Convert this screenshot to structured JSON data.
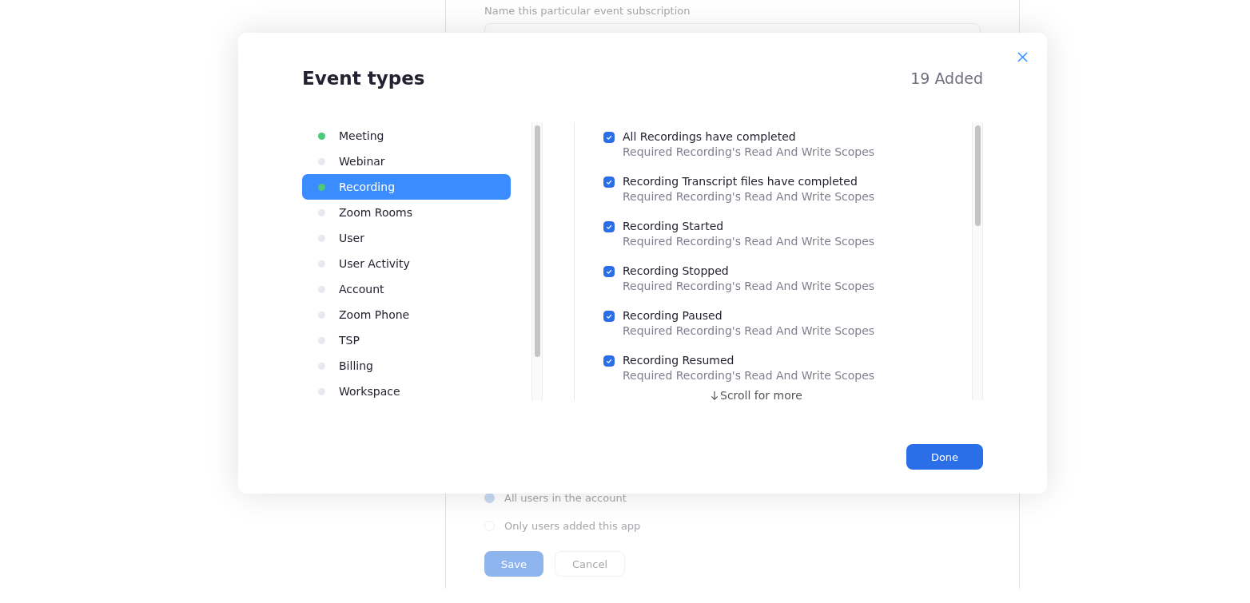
{
  "background_form": {
    "name_hint": "Name this particular event subscription",
    "user_options": [
      {
        "label": "All users in the account",
        "selected": true
      },
      {
        "label": "Only users added this app",
        "selected": false
      }
    ],
    "buttons": [
      {
        "kind": "primary",
        "label": "Save"
      },
      {
        "kind": "secondary",
        "label": "Cancel"
      }
    ]
  },
  "dialog": {
    "title": "Event types",
    "count": "19 Added",
    "categories": [
      {
        "label": "Meeting",
        "subscribed": true,
        "selected": false
      },
      {
        "label": "Webinar",
        "subscribed": false,
        "selected": false
      },
      {
        "label": "Recording",
        "subscribed": true,
        "selected": true
      },
      {
        "label": "Zoom Rooms",
        "subscribed": false,
        "selected": false
      },
      {
        "label": "User",
        "subscribed": false,
        "selected": false
      },
      {
        "label": "User Activity",
        "subscribed": false,
        "selected": false
      },
      {
        "label": "Account",
        "subscribed": false,
        "selected": false
      },
      {
        "label": "Zoom Phone",
        "subscribed": false,
        "selected": false
      },
      {
        "label": "TSP",
        "subscribed": false,
        "selected": false
      },
      {
        "label": "Billing",
        "subscribed": false,
        "selected": false
      },
      {
        "label": "Workspace",
        "subscribed": false,
        "selected": false
      }
    ],
    "events": [
      {
        "label": "All Recordings have completed",
        "note": "Required Recording's Read And Write Scopes",
        "checked": true
      },
      {
        "label": "Recording Transcript files have completed",
        "note": "Required Recording's Read And Write Scopes",
        "checked": true
      },
      {
        "label": "Recording Started",
        "note": "Required Recording's Read And Write Scopes",
        "checked": true
      },
      {
        "label": "Recording Stopped",
        "note": "Required Recording's Read And Write Scopes",
        "checked": true
      },
      {
        "label": "Recording Paused",
        "note": "Required Recording's Read And Write Scopes",
        "checked": true
      },
      {
        "label": "Recording Resumed",
        "note": "Required Recording's Read And Write Scopes",
        "checked": true
      }
    ],
    "scroll_hint": "Scroll for more",
    "done_button": "Done"
  }
}
